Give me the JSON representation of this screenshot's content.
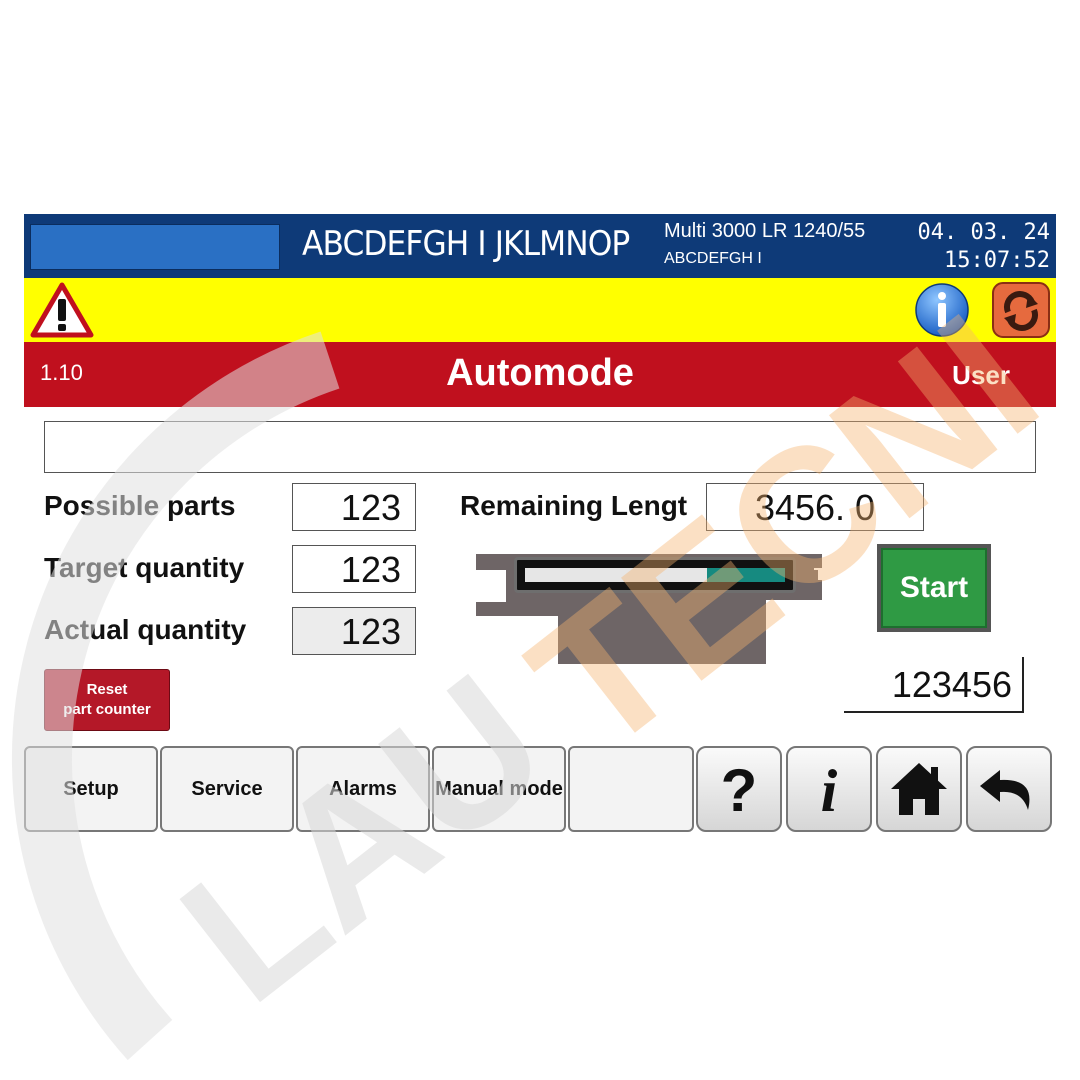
{
  "header": {
    "plant_name": "ABCDEFGH I JKLMNOP",
    "machine_name": "Multi 3000 LR 1240/55",
    "machine_sub": "ABCDEFGH I",
    "date": "04. 03. 24",
    "time": "15:07:52"
  },
  "alarm_bar": {
    "icons": [
      "warning-icon",
      "info-icon",
      "refresh-icon"
    ]
  },
  "title_bar": {
    "screen_number": "1.10",
    "title": "Automode",
    "user": "User"
  },
  "message_field": {
    "text": ""
  },
  "fields": {
    "possible_parts": {
      "label": "Possible parts",
      "value": "123"
    },
    "target_quantity": {
      "label": "Target quantity",
      "value": "123"
    },
    "actual_quantity": {
      "label": "Actual quantity",
      "value": "123"
    },
    "remaining_length": {
      "label": "Remaining Lengt",
      "value": "3456. 0"
    }
  },
  "progress": {
    "remaining_fraction": 0.3
  },
  "start_button": {
    "label": "Start",
    "color": "#2f9a44"
  },
  "counter": {
    "value": "123456"
  },
  "reset_button": {
    "line1": "Reset",
    "line2": "part counter"
  },
  "nav": {
    "setup": "Setup",
    "service": "Service",
    "alarms": "Alarms",
    "manual_mode": "Manual mode",
    "empty": "",
    "icons": [
      "help-icon",
      "info-icon",
      "home-icon",
      "back-icon"
    ]
  },
  "colors": {
    "header_blue": "#0e3a78",
    "alarm_yellow": "#ffff00",
    "title_red": "#c0101e",
    "progress_teal": "#168a80"
  },
  "watermark": {
    "text": "LAUTECNICA"
  }
}
